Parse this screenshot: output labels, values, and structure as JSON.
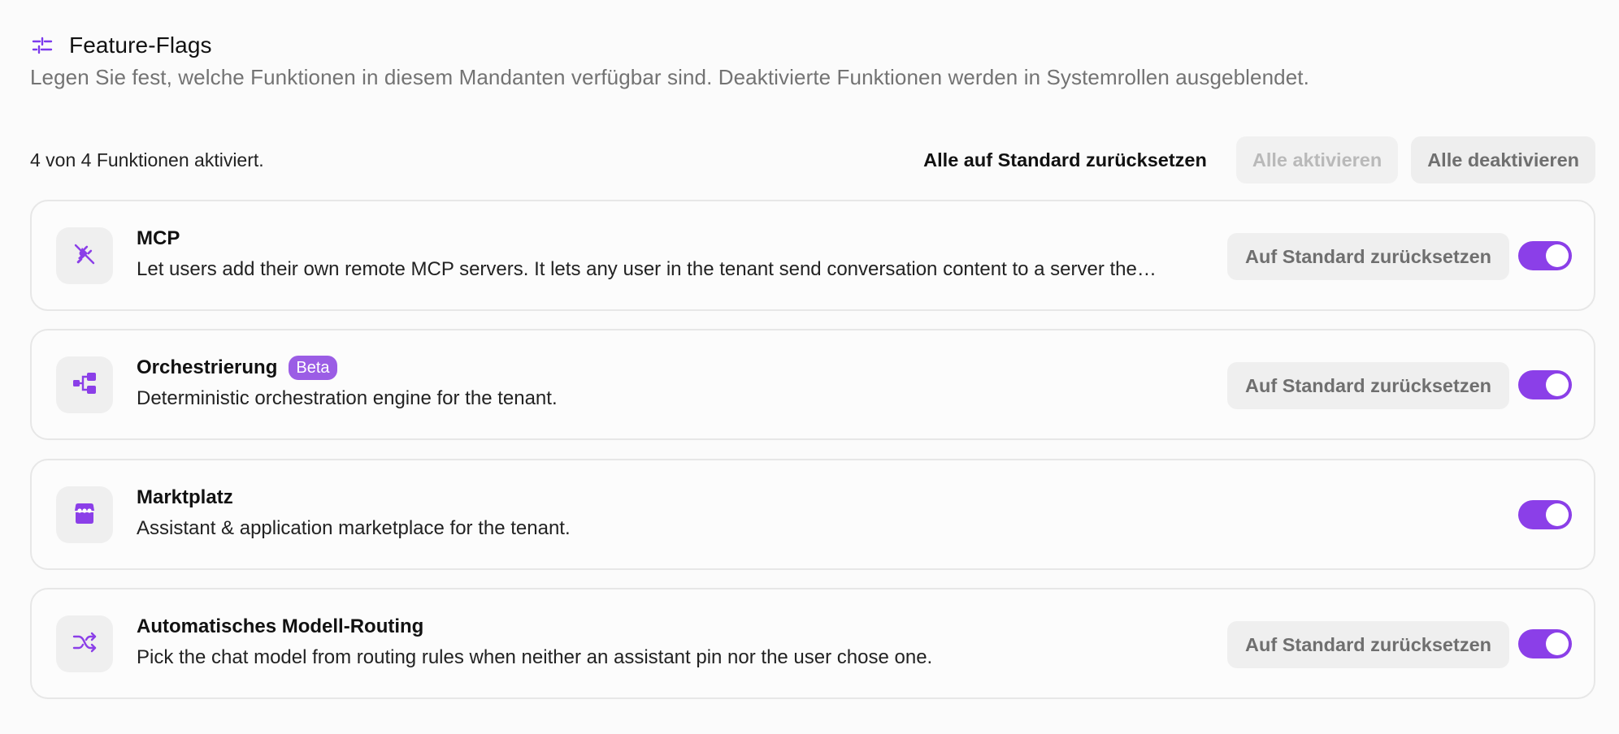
{
  "header": {
    "title": "Feature-Flags",
    "subtitle": "Legen Sie fest, welche Funktionen in diesem Mandanten verfügbar sind. Deaktivierte Funktionen werden in Systemrollen ausgeblendet."
  },
  "toolbar": {
    "count_text": "4 von 4 Funktionen aktiviert.",
    "reset_all_label": "Alle auf Standard zurücksetzen",
    "enable_all_label": "Alle aktivieren",
    "disable_all_label": "Alle deaktivieren"
  },
  "features": [
    {
      "icon": "plug-off-icon",
      "title": "MCP",
      "badge": "",
      "description": "Let users add their own remote MCP servers. It lets any user in the tenant send conversation content to a server the…",
      "reset_label": "Auf Standard zurücksetzen",
      "enabled": true
    },
    {
      "icon": "workflow-icon",
      "title": "Orchestrierung",
      "badge": "Beta",
      "description": "Deterministic orchestration engine for the tenant.",
      "reset_label": "Auf Standard zurücksetzen",
      "enabled": true
    },
    {
      "icon": "store-icon",
      "title": "Marktplatz",
      "badge": "",
      "description": "Assistant & application marketplace for the tenant.",
      "reset_label": "",
      "enabled": true
    },
    {
      "icon": "shuffle-icon",
      "title": "Automatisches Modell-Routing",
      "badge": "",
      "description": "Pick the chat model from routing rules when neither an assistant pin nor the user chose one.",
      "reset_label": "Auf Standard zurücksetzen",
      "enabled": true
    }
  ],
  "colors": {
    "accent": "#8b3fe8",
    "badge": "#9b5de5",
    "icon": "#8b3fe8"
  }
}
